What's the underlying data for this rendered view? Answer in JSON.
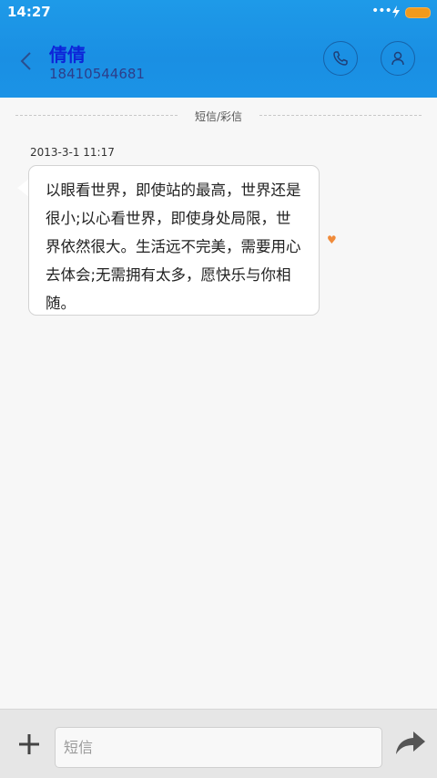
{
  "status": {
    "time": "14:27",
    "signal_dots": "•••"
  },
  "contact": {
    "name": "倩倩",
    "number": "18410544681"
  },
  "thread": {
    "separator_label": "短信/彩信"
  },
  "messages": [
    {
      "timestamp": "2013-3-1 11:17",
      "text": "以眼看世界，即使站的最高，世界还是很小;以心看世界，即使身处局限，世界依然很大。生活远不完美，需要用心去体会;无需拥有太多，愿快乐与你相随。",
      "favorite_icon": "heart-icon"
    }
  ],
  "composer": {
    "placeholder": "短信"
  },
  "colors": {
    "header": "#1a8fe3",
    "name": "#0d24d9",
    "battery": "#f19a1c",
    "heart": "#f08b3a"
  },
  "icons": [
    "back-arrow-icon",
    "phone-icon",
    "person-icon",
    "plus-icon",
    "send-arrow-icon",
    "heart-icon"
  ]
}
